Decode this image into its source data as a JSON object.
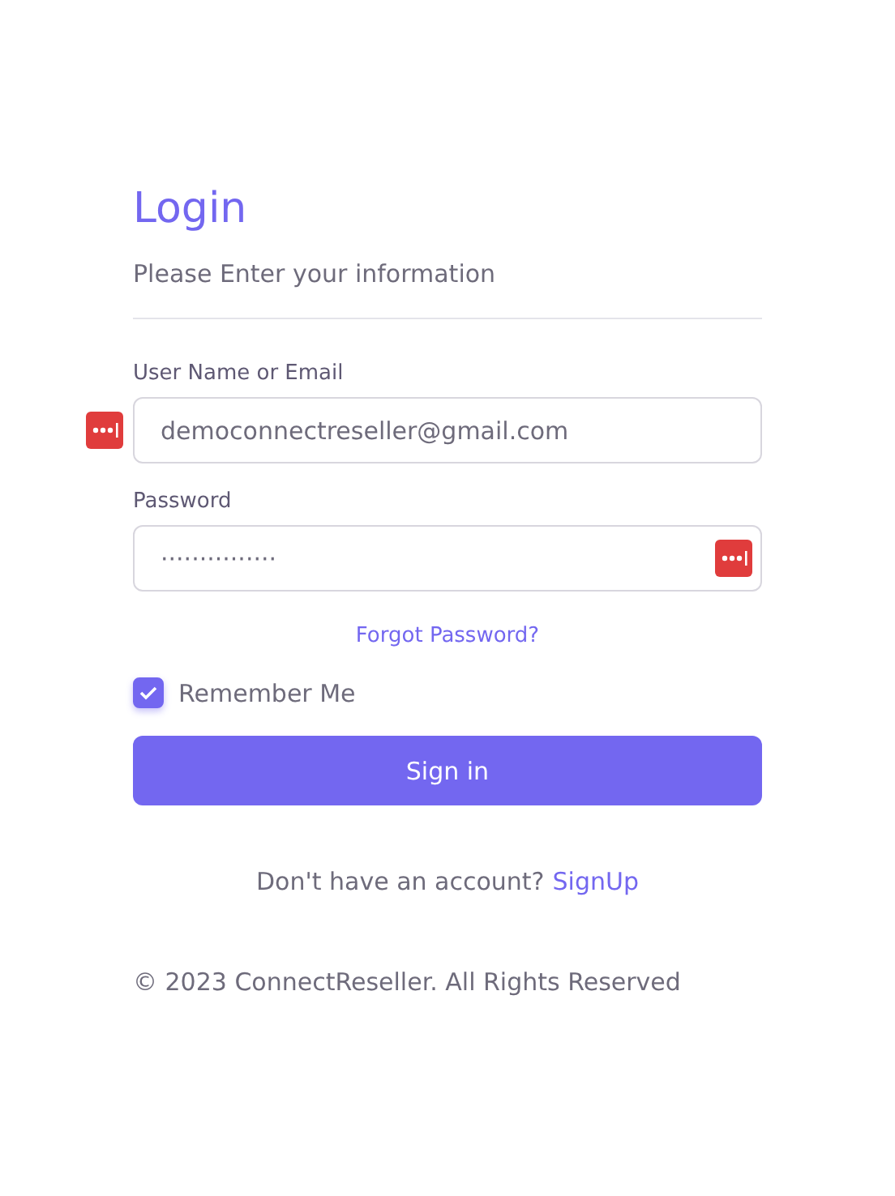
{
  "title": "Login",
  "subtitle": "Please Enter your information",
  "fields": [
    {
      "label": "User Name or Email",
      "value": "democonnectreseller@gmail.com",
      "kind": "username"
    },
    {
      "label": "Password",
      "value": "···············",
      "kind": "password"
    }
  ],
  "forgot_link": "Forgot Password?",
  "remember": {
    "label": "Remember Me",
    "checked": true
  },
  "submit": "Sign in",
  "signup": {
    "text": "Don't have an account?",
    "link": "SignUp"
  },
  "footer": "© 2023 ConnectReseller. All Rights Reserved"
}
